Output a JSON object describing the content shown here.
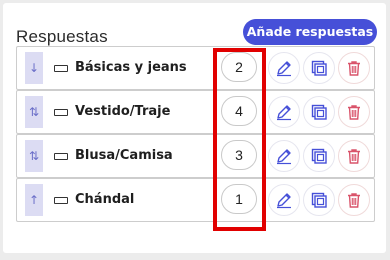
{
  "header": {
    "title": "Respuestas",
    "add_button_label": "Añade respuestas"
  },
  "answers": [
    {
      "label": "Básicas y jeans",
      "points": "2",
      "handle_icon": "↓"
    },
    {
      "label": "Vestido/Traje",
      "points": "4",
      "handle_icon": "⇅"
    },
    {
      "label": "Blusa/Camisa",
      "points": "3",
      "handle_icon": "⇅"
    },
    {
      "label": "Chándal",
      "points": "1",
      "handle_icon": "↑"
    }
  ],
  "icons": {
    "edit": "pencil-icon",
    "duplicate": "duplicate-icon",
    "delete": "trash-icon",
    "answer_type": "text-field-icon"
  },
  "colors": {
    "accent": "#4650d8",
    "handle_bg": "#dcdcf3",
    "delete": "#d9536a",
    "highlight": "#e10000"
  }
}
